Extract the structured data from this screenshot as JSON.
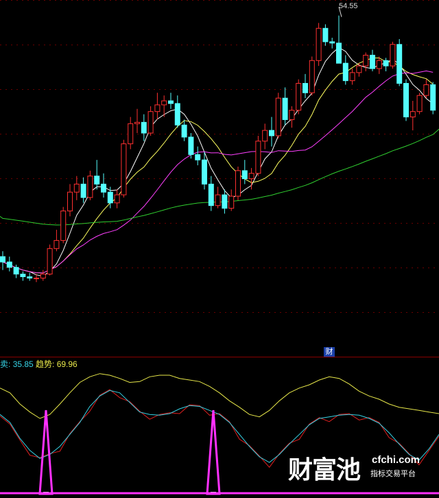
{
  "indicator": {
    "sell_label": "卖:",
    "sell_value": "35.85",
    "trend_label": "趋势:",
    "trend_value": "69.96"
  },
  "peak_label": "54.55",
  "badge": "财",
  "watermark": {
    "brand": "财富池",
    "url": "cfchi.com",
    "tagline": "指标交易平台"
  },
  "colors": {
    "up": "#ff3030",
    "down": "#54ffff",
    "ma5": "#ffffff",
    "ma10": "#ffff60",
    "ma20": "#ff40ff",
    "ma60": "#30d030",
    "grid": "#6b0000",
    "sell_line": "#36d3e6",
    "trend_line": "#e8e84a",
    "red_line": "#e02020",
    "signal": "#ff30ff"
  },
  "chart_data": [
    {
      "type": "candlestick",
      "peak": 54.55,
      "candles": [
        [
          36.6,
          37.0,
          35.6,
          36.2
        ],
        [
          36.2,
          36.6,
          35.5,
          35.8
        ],
        [
          35.8,
          36.0,
          35.0,
          35.3
        ],
        [
          35.3,
          35.5,
          34.8,
          35.1
        ],
        [
          35.1,
          35.4,
          34.8,
          35.0
        ],
        [
          35.0,
          35.3,
          34.7,
          35.0
        ],
        [
          35.0,
          35.6,
          34.8,
          35.3
        ],
        [
          35.3,
          37.5,
          35.2,
          37.2
        ],
        [
          37.2,
          38.6,
          37.0,
          37.8
        ],
        [
          37.8,
          40.3,
          37.6,
          40.0
        ],
        [
          40.0,
          42.0,
          39.6,
          41.4
        ],
        [
          41.4,
          42.6,
          40.8,
          42.0
        ],
        [
          42.0,
          42.5,
          40.6,
          41.0
        ],
        [
          41.0,
          43.0,
          40.8,
          42.6
        ],
        [
          42.6,
          43.8,
          41.6,
          42.0
        ],
        [
          42.0,
          42.8,
          41.0,
          41.4
        ],
        [
          41.4,
          41.8,
          40.2,
          40.6
        ],
        [
          40.6,
          41.6,
          40.2,
          41.2
        ],
        [
          41.2,
          45.3,
          41.0,
          45.0
        ],
        [
          45.0,
          47.0,
          44.6,
          46.5
        ],
        [
          46.5,
          47.6,
          45.8,
          46.6
        ],
        [
          46.6,
          47.2,
          45.2,
          45.8
        ],
        [
          45.8,
          47.8,
          45.6,
          47.4
        ],
        [
          47.4,
          48.8,
          46.8,
          47.9
        ],
        [
          47.9,
          48.6,
          47.0,
          48.2
        ],
        [
          48.2,
          48.8,
          47.6,
          48.0
        ],
        [
          48.0,
          48.6,
          46.2,
          46.4
        ],
        [
          46.4,
          46.8,
          45.2,
          45.5
        ],
        [
          45.5,
          45.8,
          43.9,
          44.2
        ],
        [
          44.2,
          44.8,
          43.4,
          43.8
        ],
        [
          43.8,
          44.4,
          41.6,
          42.0
        ],
        [
          42.0,
          42.6,
          40.0,
          40.4
        ],
        [
          40.4,
          41.8,
          40.2,
          41.2
        ],
        [
          41.2,
          41.6,
          39.8,
          40.2
        ],
        [
          40.2,
          41.6,
          40.0,
          41.1
        ],
        [
          41.1,
          43.3,
          40.8,
          43.0
        ],
        [
          43.0,
          43.8,
          42.0,
          42.4
        ],
        [
          42.4,
          43.2,
          41.6,
          42.8
        ],
        [
          42.8,
          45.6,
          42.6,
          45.2
        ],
        [
          45.2,
          46.5,
          44.6,
          46.0
        ],
        [
          46.0,
          47.0,
          44.8,
          45.6
        ],
        [
          45.6,
          48.8,
          45.4,
          48.4
        ],
        [
          48.4,
          49.2,
          46.4,
          46.8
        ],
        [
          46.8,
          47.8,
          46.2,
          47.5
        ],
        [
          47.5,
          49.8,
          47.2,
          49.5
        ],
        [
          49.5,
          50.2,
          48.4,
          48.8
        ],
        [
          48.8,
          51.5,
          48.6,
          51.2
        ],
        [
          51.2,
          54.0,
          50.8,
          53.6
        ],
        [
          53.6,
          53.9,
          52.3,
          52.6
        ],
        [
          52.6,
          52.9,
          52.1,
          52.5
        ],
        [
          52.5,
          54.55,
          52.2,
          51.0
        ],
        [
          51.0,
          51.6,
          49.4,
          49.7
        ],
        [
          49.7,
          50.6,
          49.4,
          50.3
        ],
        [
          50.3,
          51.0,
          50.0,
          50.8
        ],
        [
          50.8,
          51.8,
          50.4,
          51.6
        ],
        [
          51.6,
          52.0,
          50.4,
          50.6
        ],
        [
          50.6,
          51.5,
          50.2,
          51.2
        ],
        [
          51.2,
          51.4,
          50.4,
          50.8
        ],
        [
          50.8,
          52.6,
          50.6,
          52.4
        ],
        [
          52.4,
          52.8,
          49.3,
          49.5
        ],
        [
          49.5,
          49.8,
          46.7,
          47.0
        ],
        [
          47.0,
          48.2,
          46.0,
          47.4
        ],
        [
          47.4,
          48.8,
          47.2,
          48.6
        ],
        [
          48.6,
          49.8,
          48.4,
          49.4
        ],
        [
          49.4,
          49.6,
          47.2,
          47.5
        ]
      ],
      "ma_series": [
        "MA5",
        "MA10",
        "MA20",
        "MA60"
      ]
    },
    {
      "type": "line",
      "series": [
        {
          "name": "卖",
          "values": [
            -5,
            -15,
            -35,
            -50,
            -60,
            -55,
            -45,
            -30,
            -15,
            5,
            18,
            25,
            22,
            10,
            -2,
            -5,
            -6,
            -4,
            2,
            6,
            5,
            0,
            -5,
            -15,
            -30,
            -45,
            -58,
            -65,
            -55,
            -42,
            -30,
            -18,
            -10,
            -8,
            -6,
            -5,
            -6,
            -10,
            -16,
            -28,
            -42,
            -55,
            -62,
            -48,
            -30
          ]
        },
        {
          "name": "趋势",
          "values": [
            28,
            22,
            8,
            -2,
            -10,
            -5,
            8,
            22,
            35,
            42,
            46,
            44,
            40,
            35,
            36,
            42,
            44,
            44,
            40,
            38,
            36,
            30,
            22,
            12,
            4,
            -5,
            -8,
            0,
            12,
            22,
            28,
            32,
            38,
            42,
            40,
            33,
            24,
            18,
            14,
            8,
            4,
            2,
            0,
            -2,
            -4
          ]
        }
      ]
    }
  ]
}
